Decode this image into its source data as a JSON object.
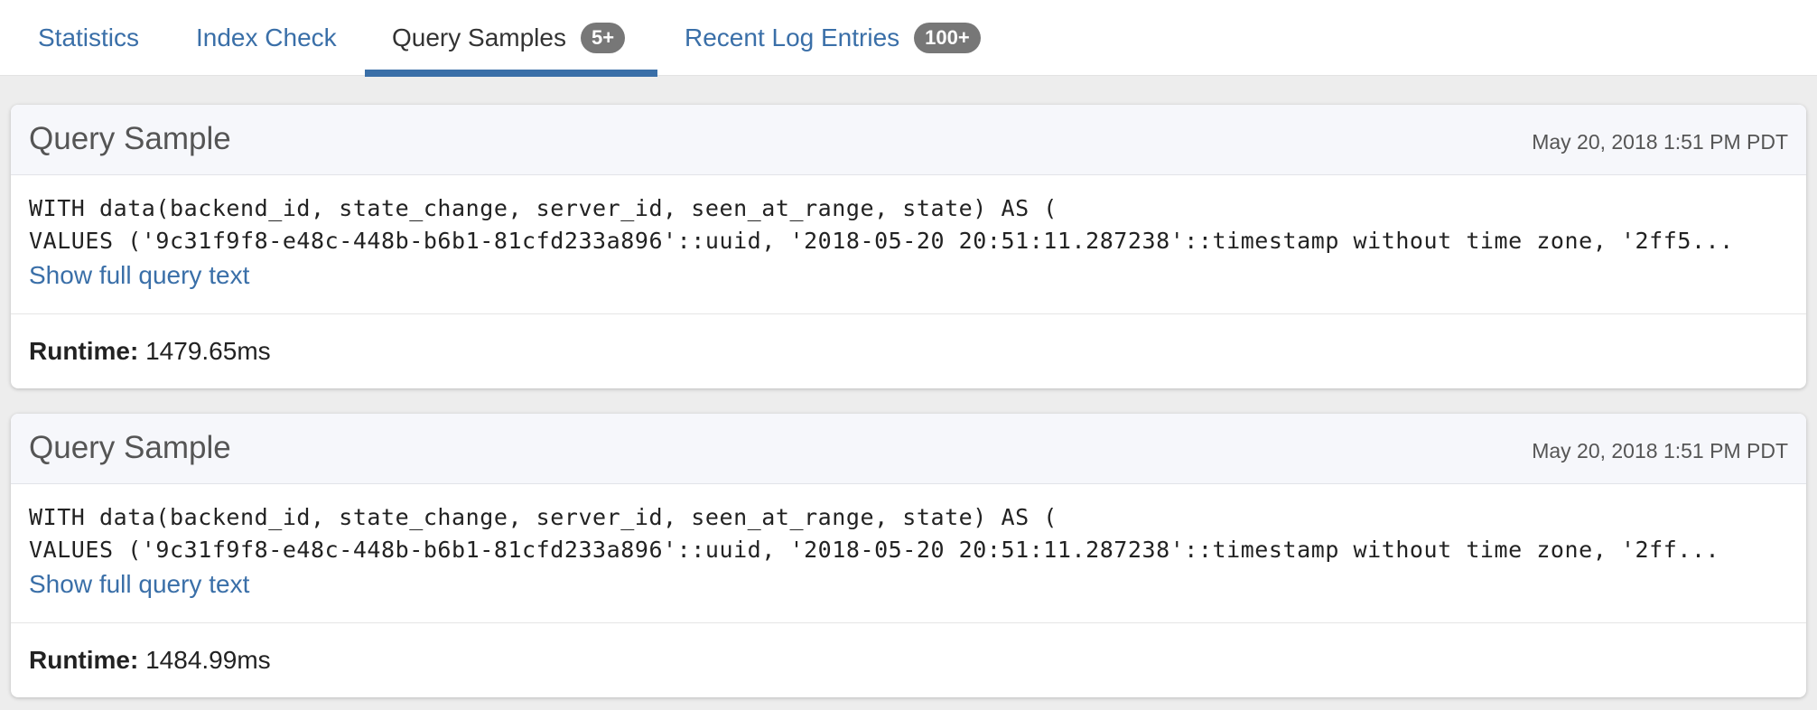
{
  "tabs": [
    {
      "label": "Statistics"
    },
    {
      "label": "Index Check"
    },
    {
      "label": "Query Samples",
      "badge": "5+",
      "active": true
    },
    {
      "label": "Recent Log Entries",
      "badge": "100+"
    }
  ],
  "colors": {
    "link": "#3a6fa8",
    "badge": "#777777",
    "page_background": "#ededed",
    "card_header": "#f6f7fb"
  },
  "samples": [
    {
      "title": "Query Sample",
      "timestamp": "May 20, 2018 1:51 PM PDT",
      "query_line_1": "WITH data(backend_id, state_change, server_id, seen_at_range, state) AS (",
      "query_line_2": "VALUES ('9c31f9f8-e48c-448b-b6b1-81cfd233a896'::uuid, '2018-05-20 20:51:11.287238'::timestamp without time zone, '2ff5...",
      "show_full_label": "Show full query text",
      "runtime_label": "Runtime:",
      "runtime_value": "1479.65ms"
    },
    {
      "title": "Query Sample",
      "timestamp": "May 20, 2018 1:51 PM PDT",
      "query_line_1": "WITH data(backend_id, state_change, server_id, seen_at_range, state) AS (",
      "query_line_2": "VALUES ('9c31f9f8-e48c-448b-b6b1-81cfd233a896'::uuid, '2018-05-20 20:51:11.287238'::timestamp without time zone, '2ff...",
      "show_full_label": "Show full query text",
      "runtime_label": "Runtime:",
      "runtime_value": "1484.99ms"
    }
  ]
}
